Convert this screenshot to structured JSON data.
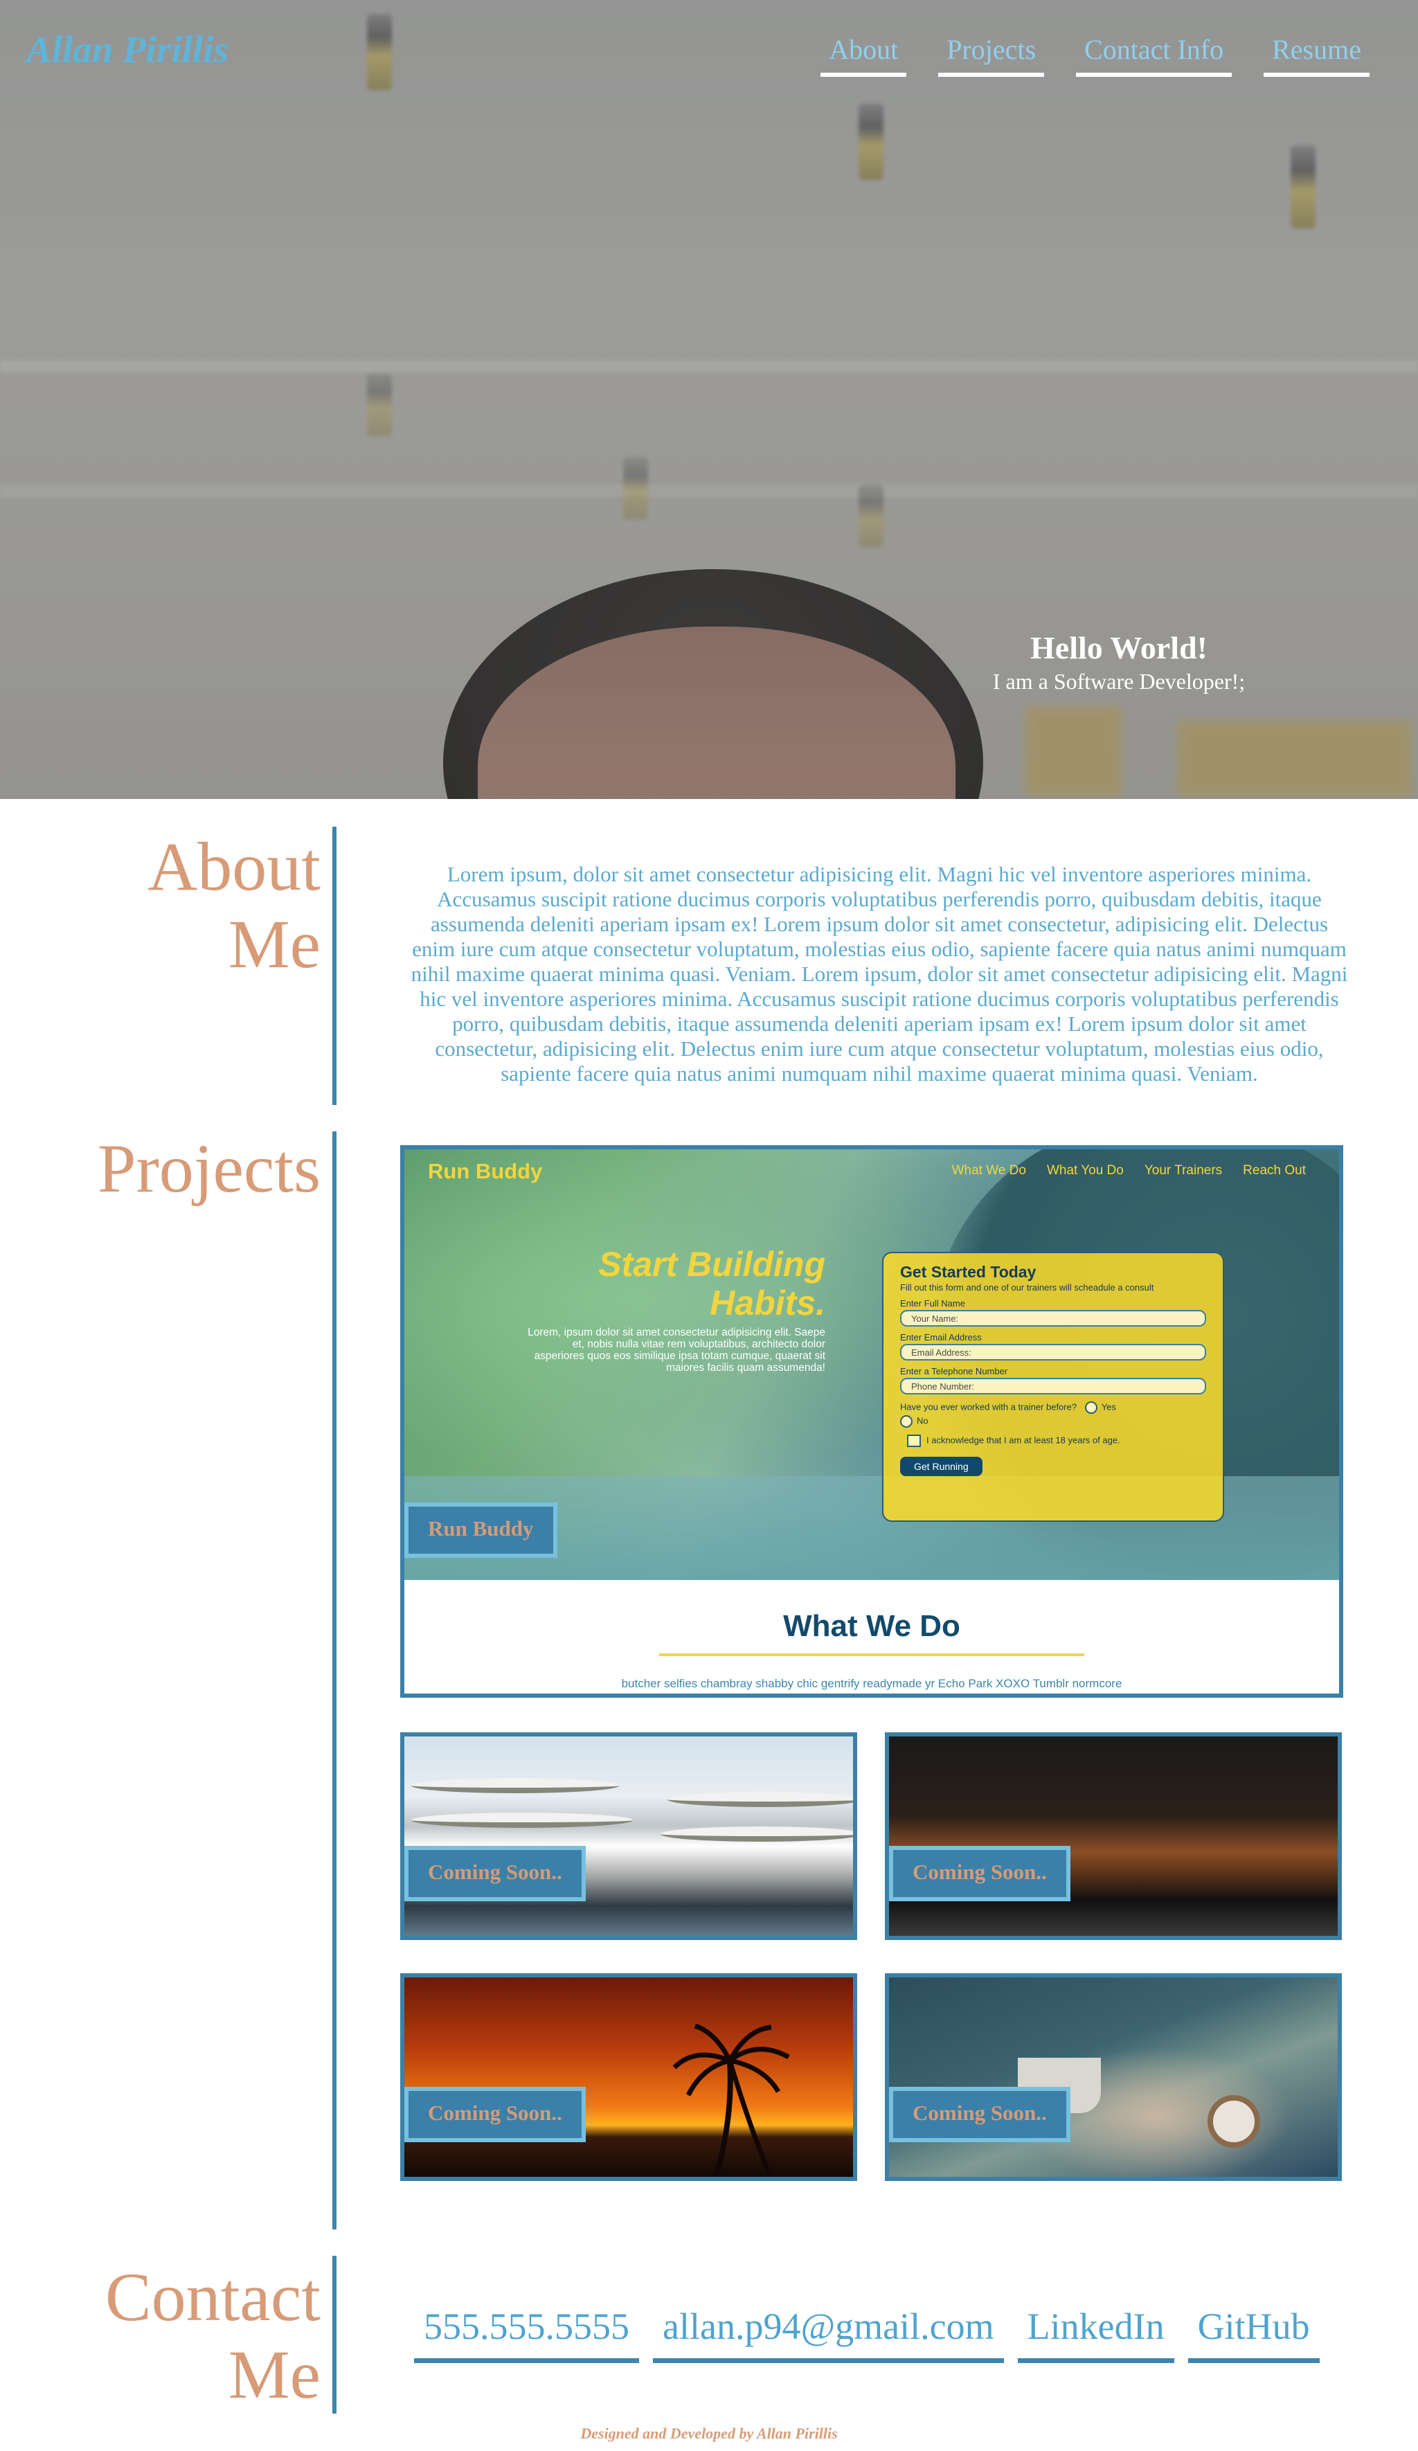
{
  "header": {
    "brand": "Allan Pirillis",
    "nav": [
      "About",
      "Projects",
      "Contact Info",
      "Resume"
    ]
  },
  "hero": {
    "title": "Hello World!",
    "subtitle": "I am a Software Developer!;"
  },
  "about": {
    "title_line1": "About",
    "title_line2": "Me",
    "body": "Lorem ipsum, dolor sit amet consectetur adipisicing elit. Magni hic vel inventore asperiores minima. Accusamus suscipit ratione ducimus corporis voluptatibus perferendis porro, quibusdam debitis, itaque assumenda deleniti aperiam ipsam ex! Lorem ipsum dolor sit amet consectetur, adipisicing elit. Delectus enim iure cum atque consectetur voluptatum, molestias eius odio, sapiente facere quia natus animi numquam nihil maxime quaerat minima quasi. Veniam. Lorem ipsum, dolor sit amet consectetur adipisicing elit. Magni hic vel inventore asperiores minima. Accusamus suscipit ratione ducimus corporis voluptatibus perferendis porro, quibusdam debitis, itaque assumenda deleniti aperiam ipsam ex! Lorem ipsum dolor sit amet consectetur, adipisicing elit. Delectus enim iure cum atque consectetur voluptatum, molestias eius odio, sapiente facere quia natus animi numquam nihil maxime quaerat minima quasi. Veniam."
  },
  "projects": {
    "title": "Projects",
    "featured": {
      "label": "Run Buddy",
      "screenshot": {
        "logo": "Run Buddy",
        "nav": [
          "What We Do",
          "What You Do",
          "Your Trainers",
          "Reach Out"
        ],
        "hero_title_line1": "Start Building",
        "hero_title_line2": "Habits.",
        "hero_body": "Lorem, ipsum dolor sit amet consectetur adipisicing elit. Saepe et, nobis nulla vitae rem voluptatibus, architecto dolor asperiores quos eos similique ipsa totam cumque, quaerat sit maiores facilis quam assumenda!",
        "form": {
          "title": "Get Started Today",
          "subtitle": "Fill out this form and one of our trainers will scheadule a consult",
          "name_label": "Enter Full Name",
          "name_placeholder": "Your Name:",
          "email_label": "Enter Email Address",
          "email_placeholder": "Email Address:",
          "phone_label": "Enter a Telephone Number",
          "phone_placeholder": "Phone Number:",
          "question": "Have you ever worked with a trainer before?",
          "yes": "Yes",
          "no": "No",
          "ack": "I acknowledge that I am at least 18 years of age.",
          "button": "Get Running"
        },
        "section_title": "What We Do",
        "section_text": "butcher selfies chambray shabby chic gentrify readymade yr Echo Park XOXO Tumblr normcore"
      }
    },
    "coming_soon": [
      {
        "label": "Coming Soon..",
        "image": "architecture"
      },
      {
        "label": "Coming Soon..",
        "image": "desk-do-more"
      },
      {
        "label": "Coming Soon..",
        "image": "sunset-palm"
      },
      {
        "label": "Coming Soon..",
        "image": "coffee-watch"
      }
    ]
  },
  "contact": {
    "title_line1": "Contact",
    "title_line2": "Me",
    "links": [
      "555.555.5555",
      "allan.p94@gmail.com",
      "LinkedIn",
      "GitHub"
    ]
  },
  "footer": {
    "text": "Designed and Developed by Allan Pirillis"
  },
  "colors": {
    "accent_blue": "#3a86ad",
    "link_blue": "#4fa3cf",
    "heading_tan": "#d79b77"
  }
}
